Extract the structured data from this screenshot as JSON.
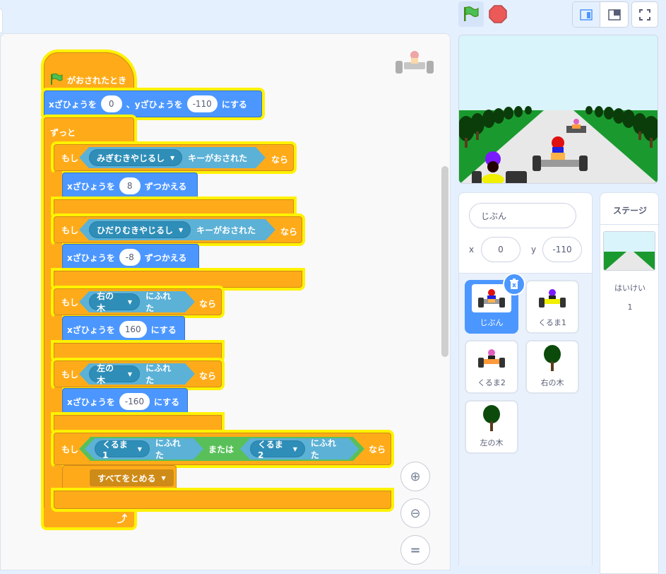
{
  "script": {
    "hat_label": "がおされたとき",
    "goto_x_label": "xざひょうを",
    "goto_sep": "、yざひょうを",
    "goto_x": "0",
    "goto_y": "-110",
    "goto_suffix": "にする",
    "forever_label": "ずっと",
    "if1": {
      "if": "もし",
      "key": "みぎむきやじるし",
      "pressed": "キーがおされた",
      "then": "なら",
      "action_label": "xざひょうを",
      "value": "8",
      "action_suffix": "ずつかえる"
    },
    "if2": {
      "if": "もし",
      "key": "ひだりむきやじるし",
      "pressed": "キーがおされた",
      "then": "なら",
      "action_label": "xざひょうを",
      "value": "-8",
      "action_suffix": "ずつかえる"
    },
    "if3": {
      "if": "もし",
      "target": "右の木",
      "touching": "にふれた",
      "then": "なら",
      "action_label": "xざひょうを",
      "value": "160",
      "action_suffix": "にする"
    },
    "if4": {
      "if": "もし",
      "target": "左の木",
      "touching": "にふれた",
      "then": "なら",
      "action_label": "xざひょうを",
      "value": "-160",
      "action_suffix": "にする"
    },
    "if5": {
      "if": "もし",
      "target1": "くるま1",
      "touching1": "にふれた",
      "or": "または",
      "target2": "くるま2",
      "touching2": "にふれた",
      "then": "なら",
      "stop": "すべてをとめる"
    }
  },
  "sprite_info": {
    "name": "じぶん",
    "x_label": "x",
    "x_value": "0",
    "y_label": "y",
    "y_value": "-110"
  },
  "sprites": [
    {
      "name": "じぶん",
      "selected": true,
      "icon": "red-kart-icon"
    },
    {
      "name": "くるま1",
      "selected": false,
      "icon": "purple-kart-icon"
    },
    {
      "name": "くるま2",
      "selected": false,
      "icon": "pink-kart-icon"
    },
    {
      "name": "右の木",
      "selected": false,
      "icon": "tree-icon"
    },
    {
      "name": "左の木",
      "selected": false,
      "icon": "tree-icon"
    }
  ],
  "stage_panel": {
    "title": "ステージ",
    "backdrop_label": "はいけい",
    "backdrop_count": "1"
  },
  "colors": {
    "control": "#ffab19",
    "motion": "#4c97ff",
    "sensing": "#5cb1d6",
    "operator": "#59c059",
    "highlight": "#fff200"
  }
}
